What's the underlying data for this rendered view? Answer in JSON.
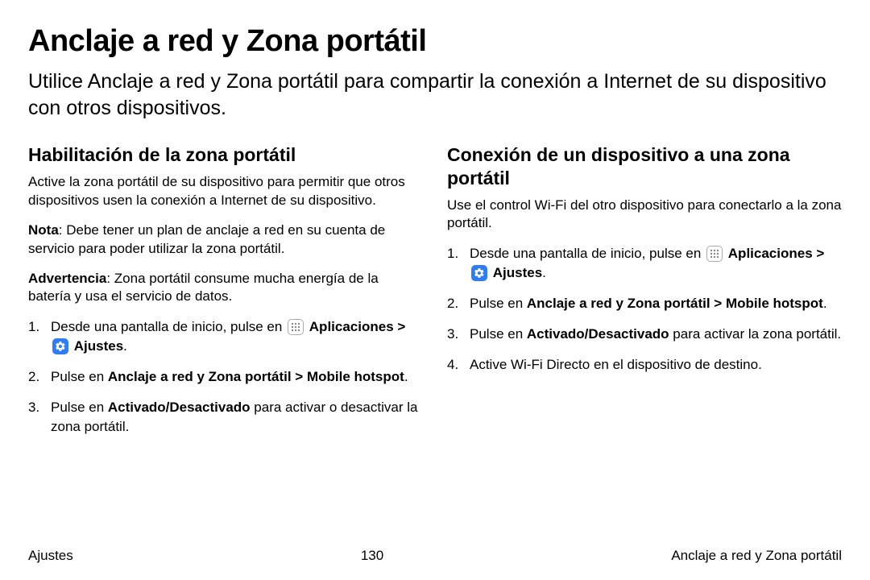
{
  "title": "Anclaje a red y Zona portátil",
  "intro": "Utilice Anclaje a red y Zona portátil para compartir la conexión a Internet de su dispositivo con otros dispositivos.",
  "left": {
    "heading": "Habilitación de la zona portátil",
    "p1": "Active la zona portátil de su dispositivo para permitir que otros dispositivos usen la conexión a Internet de su dispositivo.",
    "note_label": "Nota",
    "note_text": ": Debe tener un plan de anclaje a red en su cuenta de servicio para poder utilizar la zona portátil.",
    "warn_label": "Advertencia",
    "warn_text": ": Zona portátil consume mucha energía de la batería y usa el servicio de datos.",
    "s1a": "Desde una pantalla de inicio, pulse en ",
    "s1_apps": "Aplicaciones",
    "s1_sep": " > ",
    "s1_settings": "Ajustes",
    "s1_end": ".",
    "s2a": "Pulse en ",
    "s2b": "Anclaje a red y Zona portátil",
    "s2_sep": " > ",
    "s2c": "Mobile hotspot",
    "s2_end": ".",
    "s3a": "Pulse en ",
    "s3b": "Activado/Desactivado",
    "s3c": " para activar o desactivar la zona portátil."
  },
  "right": {
    "heading": "Conexión de un dispositivo a una zona portátil",
    "p1": "Use el control Wi-Fi del otro dispositivo para conectarlo a la zona portátil.",
    "s1a": "Desde una pantalla de inicio, pulse en ",
    "s1_apps": "Aplicaciones",
    "s1_sep": " > ",
    "s1_settings": "Ajustes",
    "s1_end": ".",
    "s2a": "Pulse en ",
    "s2b": "Anclaje a red y Zona portátil",
    "s2_sep": " > ",
    "s2c": "Mobile hotspot",
    "s2_end": ".",
    "s3a": "Pulse en ",
    "s3b": "Activado/Desactivado",
    "s3c": " para activar la zona portátil.",
    "s4": "Active Wi-Fi Directo en el dispositivo de destino."
  },
  "footer": {
    "left": "Ajustes",
    "center": "130",
    "right": "Anclaje a red y Zona portátil"
  }
}
